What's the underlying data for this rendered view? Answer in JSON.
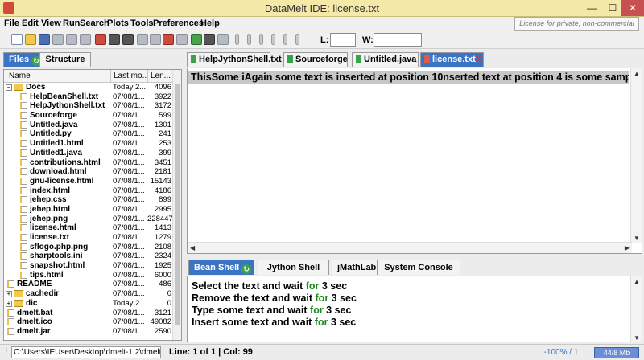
{
  "window": {
    "title": "DataMelt IDE: license.txt",
    "min": "—",
    "max": "☐",
    "close": "✕"
  },
  "menu": [
    "File",
    "Edit",
    "View",
    "Run",
    "Search",
    "Plots",
    "Tools",
    "Preferences",
    "Help"
  ],
  "license_note": "License for private, non-commercial use",
  "toolbar": {
    "l_label": "L:",
    "w_label": "W:",
    "l_value": "",
    "w_value": ""
  },
  "left_tabs": {
    "files": "Files",
    "structure": "Structure"
  },
  "file_table": {
    "headers": [
      "Name",
      "Last mo...",
      "Len..."
    ],
    "rows": [
      {
        "name": "Docs",
        "date": "Today  2...",
        "size": "4096",
        "type": "folder",
        "expander": "−",
        "level": 0
      },
      {
        "name": "HelpBeanShell.txt",
        "date": "07/08/1...",
        "size": "3922",
        "type": "file",
        "level": 1
      },
      {
        "name": "HelpJythonShell.txt",
        "date": "07/08/1...",
        "size": "3172",
        "type": "file",
        "level": 1
      },
      {
        "name": "Sourceforge",
        "date": "07/08/1...",
        "size": "599",
        "type": "file",
        "level": 1
      },
      {
        "name": "Untitled.java",
        "date": "07/08/1...",
        "size": "1301",
        "type": "file",
        "level": 1
      },
      {
        "name": "Untitled.py",
        "date": "07/08/1...",
        "size": "241",
        "type": "file",
        "level": 1
      },
      {
        "name": "Untitled1.html",
        "date": "07/08/1...",
        "size": "253",
        "type": "file",
        "level": 1
      },
      {
        "name": "Untitled1.java",
        "date": "07/08/1...",
        "size": "399",
        "type": "file",
        "level": 1
      },
      {
        "name": "contributions.html",
        "date": "07/08/1...",
        "size": "3451",
        "type": "file",
        "level": 1
      },
      {
        "name": "download.html",
        "date": "07/08/1...",
        "size": "2181",
        "type": "file",
        "level": 1
      },
      {
        "name": "gnu-license.html",
        "date": "07/08/1...",
        "size": "15143",
        "type": "file",
        "level": 1
      },
      {
        "name": "index.html",
        "date": "07/08/1...",
        "size": "4186",
        "type": "file",
        "level": 1
      },
      {
        "name": "jehep.css",
        "date": "07/08/1...",
        "size": "899",
        "type": "file",
        "level": 1
      },
      {
        "name": "jehep.html",
        "date": "07/08/1...",
        "size": "2995",
        "type": "file",
        "level": 1
      },
      {
        "name": "jehep.png",
        "date": "07/08/1...",
        "size": "228447",
        "type": "file",
        "level": 1
      },
      {
        "name": "license.html",
        "date": "07/08/1...",
        "size": "1413",
        "type": "file",
        "level": 1
      },
      {
        "name": "license.txt",
        "date": "07/08/1...",
        "size": "1279",
        "type": "file",
        "level": 1
      },
      {
        "name": "sflogo.php.png",
        "date": "07/08/1...",
        "size": "2108",
        "type": "file",
        "level": 1
      },
      {
        "name": "sharptools.ini",
        "date": "07/08/1...",
        "size": "2324",
        "type": "file",
        "level": 1
      },
      {
        "name": "snapshot.html",
        "date": "07/08/1...",
        "size": "1925",
        "type": "file",
        "level": 1
      },
      {
        "name": "tips.html",
        "date": "07/08/1...",
        "size": "6000",
        "type": "file",
        "level": 1
      },
      {
        "name": "README",
        "date": "07/08/1...",
        "size": "486",
        "type": "file",
        "level": 0
      },
      {
        "name": "cachedir",
        "date": "07/08/1...",
        "size": "0",
        "type": "folder",
        "expander": "+",
        "level": 0
      },
      {
        "name": "dic",
        "date": "Today  2...",
        "size": "0",
        "type": "folder",
        "expander": "+",
        "level": 0
      },
      {
        "name": "dmelt.bat",
        "date": "07/08/1...",
        "size": "3121",
        "type": "file",
        "level": 0
      },
      {
        "name": "dmelt.ico",
        "date": "07/08/1...",
        "size": "49082",
        "type": "file",
        "level": 0
      },
      {
        "name": "dmelt.jar",
        "date": "07/08/1...",
        "size": "2590",
        "type": "file",
        "level": 0
      }
    ]
  },
  "editor_tabs": [
    "HelpJythonShell.txt",
    "Sourceforge",
    "Untitled.java",
    "license.txt"
  ],
  "editor_text": "ThisSome iAgain some text is  inserted at position 10nserted text at position 4 is some samp",
  "console_tabs": [
    "Bean Shell",
    "Jython Shell",
    "jMathLab Shell",
    "System Console"
  ],
  "console_lines": [
    {
      "pre": "Select the text and wait ",
      "kw": "for",
      "post": " 3 sec"
    },
    {
      "pre": "Remove the text and wait ",
      "kw": "for",
      "post": " 3 sec"
    },
    {
      "pre": "Type some text and wait ",
      "kw": "for",
      "post": " 3 sec"
    },
    {
      "pre": "Insert some text and wait ",
      "kw": "for",
      "post": " 3 sec"
    }
  ],
  "status": {
    "path": "C:\\Users\\IEUser\\Desktop\\dmelt-1.2\\dmelt",
    "position": "Line: 1 of 1 | Col: 99",
    "zoom": "-100% / 1",
    "memory": "44/8 Mb"
  }
}
